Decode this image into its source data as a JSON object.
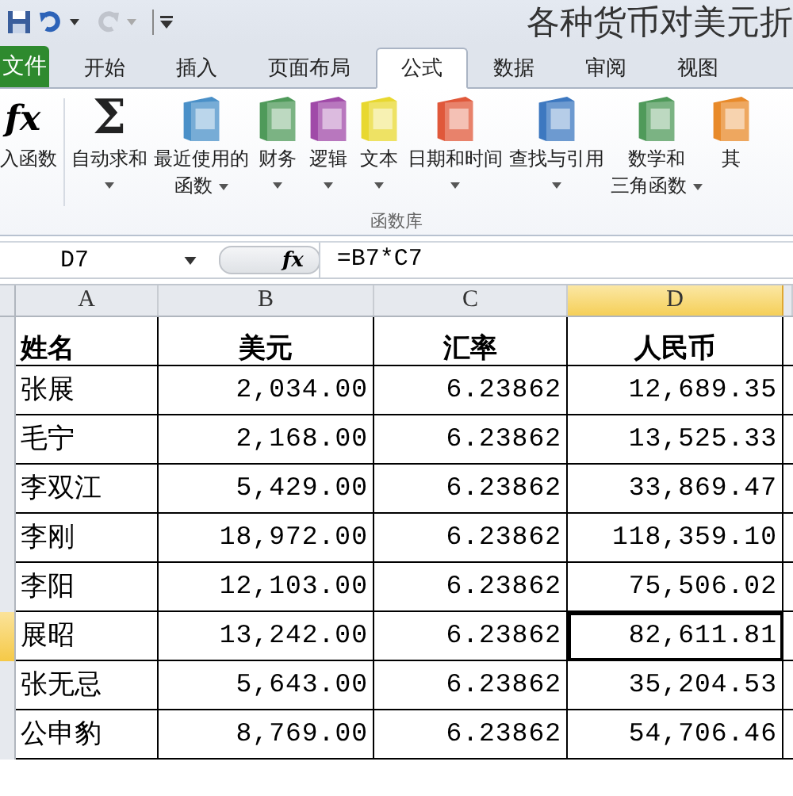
{
  "window": {
    "title": "各种货币对美元折"
  },
  "tabs": [
    {
      "label": "文件",
      "kind": "file"
    },
    {
      "label": "开始",
      "kind": "tab",
      "selected": false
    },
    {
      "label": "插入",
      "kind": "tab",
      "selected": false
    },
    {
      "label": "页面布局",
      "kind": "tab",
      "selected": false
    },
    {
      "label": "公式",
      "kind": "tab",
      "selected": true
    },
    {
      "label": "数据",
      "kind": "tab",
      "selected": false
    },
    {
      "label": "审阅",
      "kind": "tab",
      "selected": false
    },
    {
      "label": "视图",
      "kind": "tab",
      "selected": false
    }
  ],
  "ribbon": {
    "group_label": "函数库",
    "buttons": [
      {
        "kind": "fx",
        "symbol": "fx",
        "lines": [
          "入函数"
        ]
      },
      {
        "kind": "sigma",
        "symbol": "Σ",
        "lines": [
          "自动求和"
        ],
        "dropdown": true
      },
      {
        "kind": "book",
        "color": "#4a90c8",
        "lines": [
          "最近使用的",
          "函数"
        ],
        "dropdown": true
      },
      {
        "kind": "book",
        "color": "#4f9a5a",
        "lines": [
          "财务"
        ],
        "dropdown": true
      },
      {
        "kind": "book",
        "color": "#a04aa8",
        "lines": [
          "逻辑"
        ],
        "dropdown": true
      },
      {
        "kind": "book",
        "color": "#e8d830",
        "lines": [
          "文本"
        ],
        "dropdown": true
      },
      {
        "kind": "book",
        "color": "#e0583a",
        "lines": [
          "日期和时间"
        ],
        "dropdown": true
      },
      {
        "kind": "book",
        "color": "#3d78c0",
        "lines": [
          "查找与引用"
        ],
        "dropdown": true
      },
      {
        "kind": "book",
        "color": "#4f9a5a",
        "lines": [
          "数学和",
          "三角函数"
        ],
        "dropdown": true
      },
      {
        "kind": "book",
        "color": "#e88a2a",
        "lines": [
          "其"
        ]
      }
    ]
  },
  "formula_bar": {
    "name_box": "D7",
    "fx": "fx",
    "formula": "=B7*C7"
  },
  "columns": [
    {
      "label": "A",
      "selected": false
    },
    {
      "label": "B",
      "selected": false
    },
    {
      "label": "C",
      "selected": false
    },
    {
      "label": "D",
      "selected": true
    }
  ],
  "rows": [
    {
      "selected": false,
      "cells": [
        "姓名",
        "美元",
        "汇率",
        "人民币"
      ],
      "kind": "header"
    },
    {
      "selected": false,
      "cells": [
        "张展",
        "2,034.00",
        "6.23862",
        "12,689.35"
      ]
    },
    {
      "selected": false,
      "cells": [
        "毛宁",
        "2,168.00",
        "6.23862",
        "13,525.33"
      ]
    },
    {
      "selected": false,
      "cells": [
        "李双江",
        "5,429.00",
        "6.23862",
        "33,869.47"
      ]
    },
    {
      "selected": false,
      "cells": [
        "李刚",
        "18,972.00",
        "6.23862",
        "118,359.10"
      ]
    },
    {
      "selected": false,
      "cells": [
        "李阳",
        "12,103.00",
        "6.23862",
        "75,506.02"
      ]
    },
    {
      "selected": true,
      "cells": [
        "展昭",
        "13,242.00",
        "6.23862",
        "82,611.81"
      ]
    },
    {
      "selected": false,
      "cells": [
        "张无忌",
        "5,643.00",
        "6.23862",
        "35,204.53"
      ]
    },
    {
      "selected": false,
      "cells": [
        "公申豹",
        "8,769.00",
        "6.23862",
        "54,706.46"
      ]
    }
  ]
}
